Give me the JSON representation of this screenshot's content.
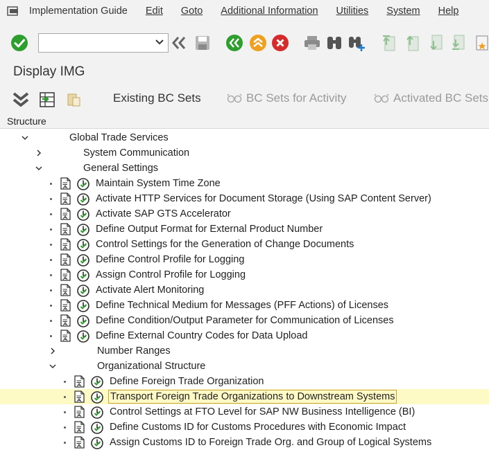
{
  "menubar": {
    "items": [
      "Implementation Guide",
      "Edit",
      "Goto",
      "Additional Information",
      "Utilities",
      "System",
      "Help"
    ]
  },
  "toolbar": {
    "command_value": ""
  },
  "title": "Display IMG",
  "apptoolbar": {
    "existing_bc_sets": "Existing BC Sets",
    "bc_sets_activity": "BC Sets for Activity",
    "activated_bc_sets": "Activated BC Sets"
  },
  "structure": {
    "header": "Structure",
    "nodes": [
      {
        "label": "Global Trade Services",
        "level": 0,
        "kind": "folder-open"
      },
      {
        "label": "System Communication",
        "level": 1,
        "kind": "folder-closed"
      },
      {
        "label": "General Settings",
        "level": 1,
        "kind": "folder-open"
      },
      {
        "label": "Maintain System Time Zone",
        "level": 2,
        "kind": "activity"
      },
      {
        "label": "Activate HTTP Services for Document Storage (Using SAP Content Server)",
        "level": 2,
        "kind": "activity"
      },
      {
        "label": "Activate SAP GTS Accelerator",
        "level": 2,
        "kind": "activity"
      },
      {
        "label": "Define Output Format for External Product Number",
        "level": 2,
        "kind": "activity"
      },
      {
        "label": "Control Settings for the Generation of Change Documents",
        "level": 2,
        "kind": "activity"
      },
      {
        "label": "Define Control Profile for Logging",
        "level": 2,
        "kind": "activity"
      },
      {
        "label": "Assign Control Profile for Logging",
        "level": 2,
        "kind": "activity"
      },
      {
        "label": "Activate Alert Monitoring",
        "level": 2,
        "kind": "activity"
      },
      {
        "label": "Define Technical Medium for Messages (PFF Actions) of Licenses",
        "level": 2,
        "kind": "activity"
      },
      {
        "label": "Define Condition/Output Parameter for Communication of Licenses",
        "level": 2,
        "kind": "activity"
      },
      {
        "label": "Define External Country Codes for Data Upload",
        "level": 2,
        "kind": "activity"
      },
      {
        "label": "Number Ranges",
        "level": 2,
        "kind": "folder-closed"
      },
      {
        "label": "Organizational Structure",
        "level": 2,
        "kind": "folder-open"
      },
      {
        "label": "Define Foreign Trade Organization",
        "level": 3,
        "kind": "activity"
      },
      {
        "label": "Transport Foreign Trade Organizations to Downstream Systems",
        "level": 3,
        "kind": "activity",
        "selected": true
      },
      {
        "label": "Control Settings at FTO Level for SAP NW Business Intelligence (BI)",
        "level": 3,
        "kind": "activity"
      },
      {
        "label": "Define Customs ID for Customs Procedures with Economic Impact",
        "level": 3,
        "kind": "activity"
      },
      {
        "label": "Assign Customs ID to Foreign Trade Org. and Group of Logical Systems",
        "level": 3,
        "kind": "activity"
      }
    ]
  },
  "colors": {
    "green": "#2e9e2e",
    "orange": "#f0a020",
    "red": "#d62b2b",
    "selection": "#fefac6"
  }
}
